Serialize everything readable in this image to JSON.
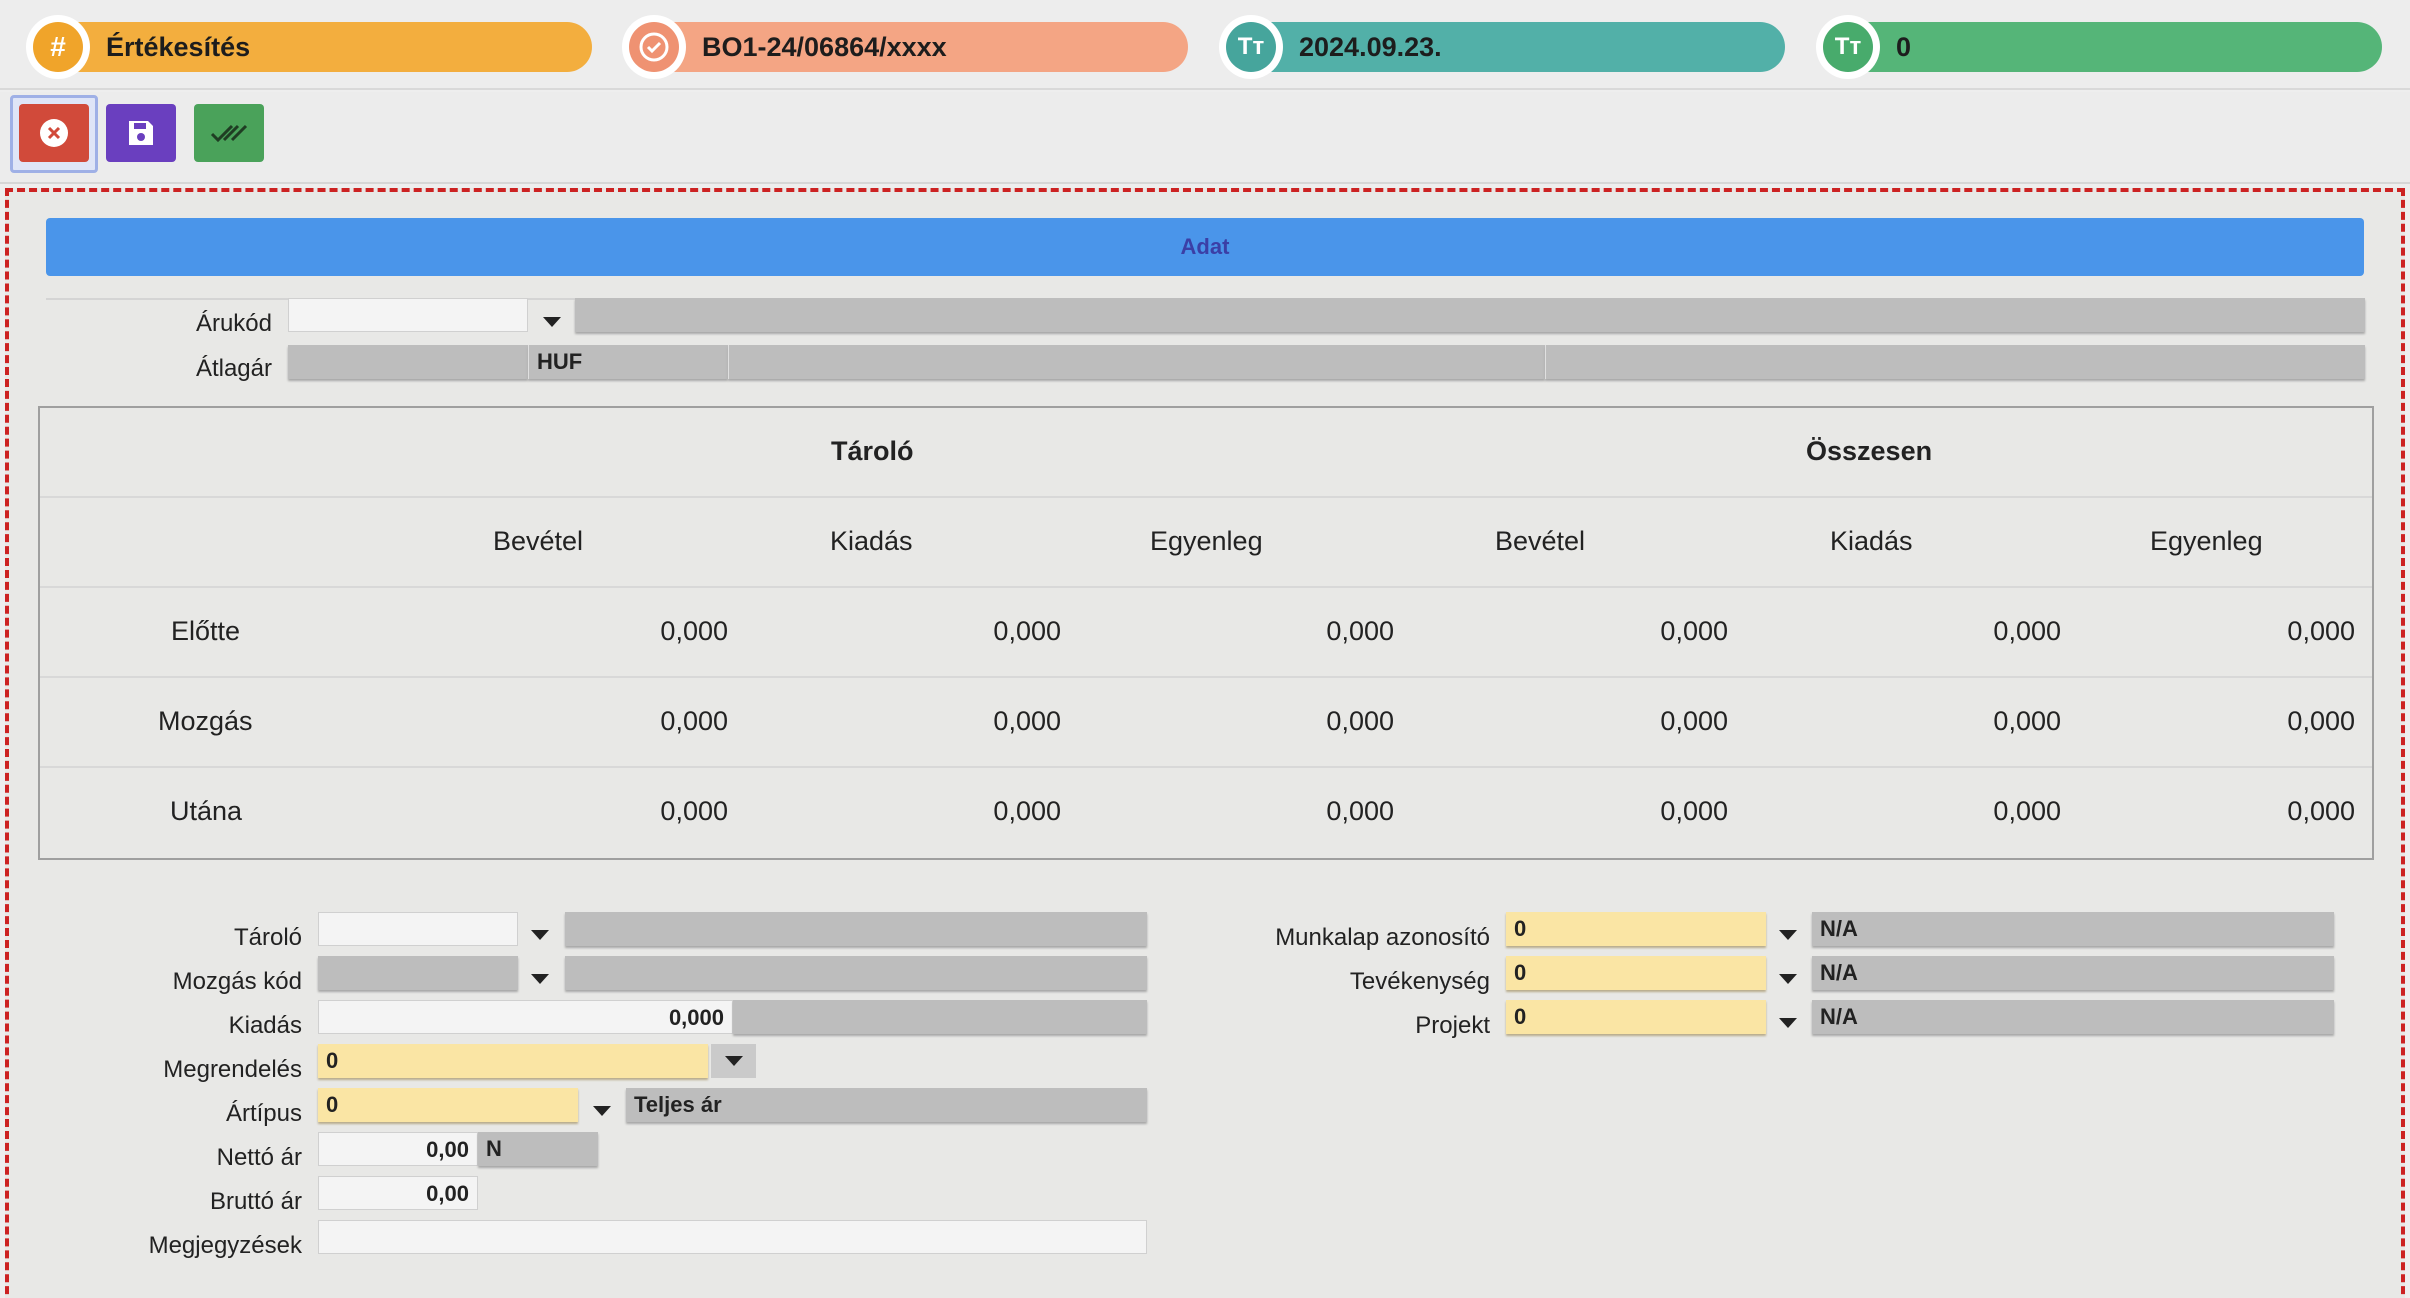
{
  "pills": [
    {
      "icon": "hash-icon",
      "symbol": "#",
      "text": "Értékesítés",
      "color": "#f3ae3e",
      "icon_color": "#f0a42a"
    },
    {
      "icon": "check-badge-icon",
      "symbol": "✓",
      "text": "BO1-24/06864/xxxx",
      "color": "#f4a584",
      "icon_color": "#ef9272"
    },
    {
      "icon": "text-type-icon",
      "symbol": "Tт",
      "text": "2024.09.23.",
      "color": "#52b0a8",
      "icon_color": "#46a59c"
    },
    {
      "icon": "text-type-icon",
      "symbol": "Tт",
      "text": "0",
      "color": "#55b578",
      "icon_color": "#48ab6c"
    }
  ],
  "toolbar": {
    "cancel": {
      "icon": "close-circle-icon",
      "color": "#d14a3a"
    },
    "save": {
      "icon": "save-icon",
      "color": "#6a3fbf"
    },
    "approve": {
      "icon": "double-check-icon",
      "color": "#4aa25a"
    }
  },
  "section_title": "Adat",
  "product": {
    "code_label": "Árukód",
    "code_value": "",
    "code_desc": "",
    "avg_label": "Átlagár",
    "avg_value": "",
    "avg_currency": "HUF"
  },
  "table": {
    "group_headers": [
      "Tároló",
      "Összesen"
    ],
    "col_headers": [
      "Bevétel",
      "Kiadás",
      "Egyenleg",
      "Bevétel",
      "Kiadás",
      "Egyenleg"
    ],
    "rows": [
      {
        "label": "Előtte",
        "values": [
          "0,000",
          "0,000",
          "0,000",
          "0,000",
          "0,000",
          "0,000"
        ]
      },
      {
        "label": "Mozgás",
        "values": [
          "0,000",
          "0,000",
          "0,000",
          "0,000",
          "0,000",
          "0,000"
        ]
      },
      {
        "label": "Utána",
        "values": [
          "0,000",
          "0,000",
          "0,000",
          "0,000",
          "0,000",
          "0,000"
        ]
      }
    ]
  },
  "form_left": {
    "storage_label": "Tároló",
    "storage_value": "",
    "storage_desc": "",
    "movement_code_label": "Mozgás kód",
    "movement_code_value": "",
    "movement_code_desc": "",
    "issue_label": "Kiadás",
    "issue_value": "0,000",
    "order_label": "Megrendelés",
    "order_value": "0",
    "price_type_label": "Ártípus",
    "price_type_value": "0",
    "price_type_desc": "Teljes ár",
    "net_label": "Nettó ár",
    "net_value": "0,00",
    "net_suffix": "N",
    "gross_label": "Bruttó ár",
    "gross_value": "0,00",
    "notes_label": "Megjegyzések",
    "notes_value": ""
  },
  "form_right": {
    "worksheet_label": "Munkalap azonosító",
    "worksheet_value": "0",
    "worksheet_desc": "N/A",
    "activity_label": "Tevékenység",
    "activity_value": "0",
    "activity_desc": "N/A",
    "project_label": "Projekt",
    "project_value": "0",
    "project_desc": "N/A"
  }
}
